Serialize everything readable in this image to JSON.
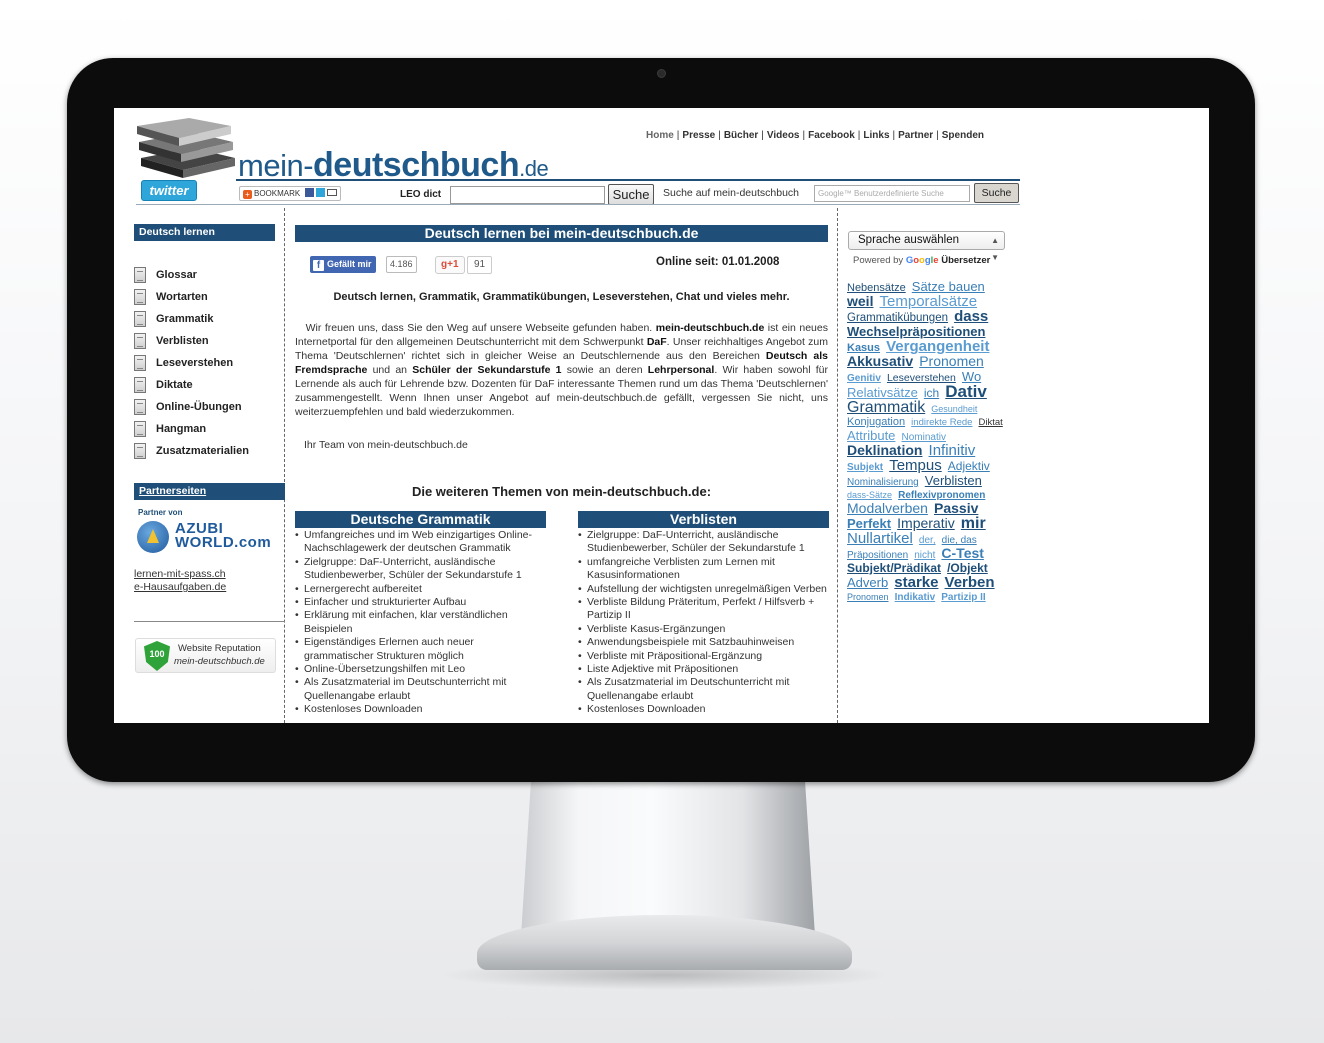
{
  "site": {
    "logo": {
      "prefix": "mein-",
      "middle": "deutschbuch",
      "tld": ".de"
    },
    "topnav": [
      "Home",
      "Presse",
      "Bücher",
      "Videos",
      "Facebook",
      "Links",
      "Partner",
      "Spenden"
    ],
    "twitter_label": "twitter",
    "bookmark_label": "BOOKMARK",
    "leo": {
      "label": "LEO dict",
      "value": "",
      "button": "Suche"
    },
    "site_search": {
      "label": "Suche auf mein-deutschbuch",
      "placeholder": "Google™ Benutzerdefinierte Suche",
      "button": "Suche"
    }
  },
  "sidebar": {
    "heading": "Deutsch lernen",
    "items": [
      "Glossar",
      "Wortarten",
      "Grammatik",
      "Verblisten",
      "Leseverstehen",
      "Diktate",
      "Online-Übungen",
      "Hangman",
      "Zusatzmaterialien"
    ],
    "partner_heading": "Partnerseiten",
    "partner_von": "Partner von",
    "azubi": {
      "line1": "AZUBI",
      "line2": "WORLD.com"
    },
    "partner_links": [
      "lernen-mit-spass.ch",
      "e-Hausaufgaben.de"
    ],
    "reputation": {
      "score": "100",
      "title": "Website Reputation",
      "site": "mein-deutschbuch.de"
    }
  },
  "main": {
    "heading": "Deutsch lernen bei mein-deutschbuch.de",
    "fb_like": "Gefällt mir",
    "fb_count": "4.186",
    "gplus": "+1",
    "gplus_count": "91",
    "online_since": "Online seit: 01.01.2008",
    "subtitle": "Deutsch lernen, Grammatik, Grammatikübungen, Leseverstehen, Chat und vieles mehr.",
    "intro": {
      "t1": "Wir freuen uns, dass Sie den Weg auf unsere Webseite gefunden haben. ",
      "b1": "mein-deutschbuch.de",
      "t2": " ist ein neues Internetportal für den allgemeinen Deutschunterricht mit dem Schwerpunkt ",
      "b2": "DaF",
      "t3": ". Unser reichhaltiges Angebot zum Thema 'Deutschlernen' richtet sich in gleicher Weise an Deutschlernende aus den Bereichen ",
      "b3": "Deutsch als Fremdsprache",
      "t4": " und an ",
      "b4": "Schüler der Sekundarstufe 1",
      "t5": " sowie an deren ",
      "b5": "Lehrpersonal",
      "t6": ". Wir haben sowohl für Lernende als auch für Lehrende bzw. Dozenten für DaF interessante Themen rund um das Thema 'Deutschlernen' zusammengestellt. Wenn Ihnen unser Angebot auf mein-deutschbuch.de gefällt, vergessen Sie nicht, uns weiterzuempfehlen und bald wiederzukommen."
    },
    "team": "Ihr Team von mein-deutschbuch.de",
    "more_heading": "Die weiteren Themen von mein-deutschbuch.de:",
    "box_grammatik": {
      "title": "Deutsche Grammatik",
      "items": [
        "Umfangreiches und im Web einzigartiges Online-Nachschlagewerk der deutschen Grammatik",
        "Zielgruppe: DaF-Unterricht, ausländische Studienbewerber, Schüler der Sekundarstufe 1",
        "Lernergerecht aufbereitet",
        "Einfacher und strukturierter Aufbau",
        "Erklärung mit einfachen, klar verständlichen Beispielen",
        "Eigenständiges Erlernen auch neuer grammatischer Strukturen möglich",
        "Online-Übersetzungshilfen mit Leo",
        "Als Zusatzmaterial im Deutschunterricht mit Quellenangabe erlaubt",
        "Kostenloses Downloaden"
      ]
    },
    "box_verblisten": {
      "title": "Verblisten",
      "items": [
        "Zielgruppe: DaF-Unterricht, ausländische Studienbewerber, Schüler der Sekundarstufe 1",
        "umfangreiche Verblisten zum Lernen mit Kasusinformationen",
        "Aufstellung der wichtigsten unregelmäßigen Verben",
        "Verbliste Bildung Präteritum, Perfekt / Hilfsverb + Partizip II",
        "Verbliste Kasus-Ergänzungen",
        "Anwendungsbeispiele mit Satzbauhinweisen",
        "Verbliste mit Präpositional-Ergänzung",
        "Liste Adjektive mit Präpositionen",
        "Als Zusatzmaterial im Deutschunterricht mit Quellenangabe erlaubt",
        "Kostenloses Downloaden"
      ]
    }
  },
  "right": {
    "language_select": "Sprache auswählen",
    "powered_by": "Powered by",
    "google": [
      "G",
      "o",
      "o",
      "g",
      "l",
      "e"
    ],
    "translator": "Übersetzer",
    "tags": [
      {
        "t": "Nebensätze",
        "s": 11,
        "b": false,
        "c": "#1f4f78"
      },
      {
        "t": "Sätze bauen",
        "s": 13,
        "b": false,
        "c": "#3a7fb6"
      },
      {
        "t": "weil",
        "s": 14,
        "b": true,
        "c": "#1f4f78"
      },
      {
        "t": "Temporalsätze",
        "s": 15,
        "b": false,
        "c": "#5a9bd0"
      },
      {
        "t": "Grammatikübungen",
        "s": 11.5,
        "b": false,
        "c": "#1f4f78"
      },
      {
        "t": "dass",
        "s": 15,
        "b": true,
        "c": "#1f4f78"
      },
      {
        "t": "Wechselpräpositionen",
        "s": 13,
        "b": true,
        "c": "#1f4f78"
      },
      {
        "t": "Kasus",
        "s": 11,
        "b": true,
        "c": "#3a7fb6"
      },
      {
        "t": "Vergangenheit",
        "s": 15,
        "b": true,
        "c": "#5a9bd0"
      },
      {
        "t": "Akkusativ",
        "s": 14,
        "b": true,
        "c": "#1f4f78"
      },
      {
        "t": "Pronomen",
        "s": 14,
        "b": false,
        "c": "#3a7fb6"
      },
      {
        "t": "Genitiv",
        "s": 10,
        "b": true,
        "c": "#5a9bd0"
      },
      {
        "t": "Leseverstehen",
        "s": 10.5,
        "b": false,
        "c": "#1f4f78"
      },
      {
        "t": "Wo",
        "s": 13,
        "b": false,
        "c": "#3a7fb6"
      },
      {
        "t": "Relativsätze",
        "s": 13,
        "b": false,
        "c": "#5a9bd0"
      },
      {
        "t": "ich",
        "s": 12,
        "b": false,
        "c": "#3a7fb6"
      },
      {
        "t": "Dativ",
        "s": 17,
        "b": true,
        "c": "#1f4f78"
      },
      {
        "t": "Grammatik",
        "s": 16,
        "b": false,
        "c": "#1f4f78"
      },
      {
        "t": "Gesundheit",
        "s": 9,
        "b": false,
        "c": "#5a9bd0"
      },
      {
        "t": "Konjugation",
        "s": 11,
        "b": false,
        "c": "#3a7fb6"
      },
      {
        "t": "indirekte Rede",
        "s": 9.5,
        "b": false,
        "c": "#5a9bd0"
      },
      {
        "t": "Diktat",
        "s": 9.5,
        "b": false,
        "c": "#333333"
      },
      {
        "t": "Attribute",
        "s": 13,
        "b": false,
        "c": "#5a9bd0"
      },
      {
        "t": "Nominativ",
        "s": 10,
        "b": false,
        "c": "#5a9bd0"
      },
      {
        "t": "Deklination",
        "s": 14,
        "b": true,
        "c": "#1f4f78"
      },
      {
        "t": "Infinitiv",
        "s": 15,
        "b": false,
        "c": "#3a7fb6"
      },
      {
        "t": "Subjekt",
        "s": 10,
        "b": true,
        "c": "#5a9bd0"
      },
      {
        "t": "Tempus",
        "s": 15,
        "b": false,
        "c": "#1f4f78"
      },
      {
        "t": "Adjektiv",
        "s": 12,
        "b": false,
        "c": "#3a7fb6"
      },
      {
        "t": "Nominalisierung",
        "s": 10,
        "b": false,
        "c": "#3a7fb6"
      },
      {
        "t": "Verblisten",
        "s": 13,
        "b": false,
        "c": "#1f4f78"
      },
      {
        "t": "dass-Sätze",
        "s": 9,
        "b": false,
        "c": "#5a9bd0"
      },
      {
        "t": "Reflexivpronomen",
        "s": 10,
        "b": true,
        "c": "#3a7fb6"
      },
      {
        "t": "Modalverben",
        "s": 14,
        "b": false,
        "c": "#3a7fb6"
      },
      {
        "t": "Passiv",
        "s": 14,
        "b": true,
        "c": "#1f4f78"
      },
      {
        "t": "Perfekt",
        "s": 13,
        "b": true,
        "c": "#3a7fb6"
      },
      {
        "t": "Imperativ",
        "s": 14,
        "b": false,
        "c": "#1f4f78"
      },
      {
        "t": "mir",
        "s": 16,
        "b": true,
        "c": "#1f4f78"
      },
      {
        "t": "Nullartikel",
        "s": 15,
        "b": false,
        "c": "#3a7fb6"
      },
      {
        "t": "der,",
        "s": 10,
        "b": false,
        "c": "#5a9bd0"
      },
      {
        "t": "die, das",
        "s": 10,
        "b": false,
        "c": "#3a7fb6"
      },
      {
        "t": "Präpositionen",
        "s": 10,
        "b": false,
        "c": "#3a7fb6"
      },
      {
        "t": "nicht",
        "s": 10,
        "b": false,
        "c": "#5a9bd0"
      },
      {
        "t": "C-Test",
        "s": 14,
        "b": true,
        "c": "#3a7fb6"
      },
      {
        "t": "Subjekt/Prädikat",
        "s": 12,
        "b": true,
        "c": "#1f4f78"
      },
      {
        "t": "/Objekt",
        "s": 12,
        "b": true,
        "c": "#1f4f78"
      },
      {
        "t": "Adverb",
        "s": 13,
        "b": false,
        "c": "#3a7fb6"
      },
      {
        "t": "starke",
        "s": 15,
        "b": true,
        "c": "#1f4f78"
      },
      {
        "t": "Verben",
        "s": 15,
        "b": true,
        "c": "#1f4f78"
      },
      {
        "t": "Pronomen",
        "s": 9,
        "b": false,
        "c": "#3a7fb6"
      },
      {
        "t": "Indikativ",
        "s": 10,
        "b": true,
        "c": "#5a9bd0"
      },
      {
        "t": "Partizip II",
        "s": 10,
        "b": true,
        "c": "#5a9bd0"
      }
    ]
  },
  "colors": {
    "brand": "#1f4f78",
    "link": "#3a7fb6",
    "bezel": "#0c0c0c"
  }
}
